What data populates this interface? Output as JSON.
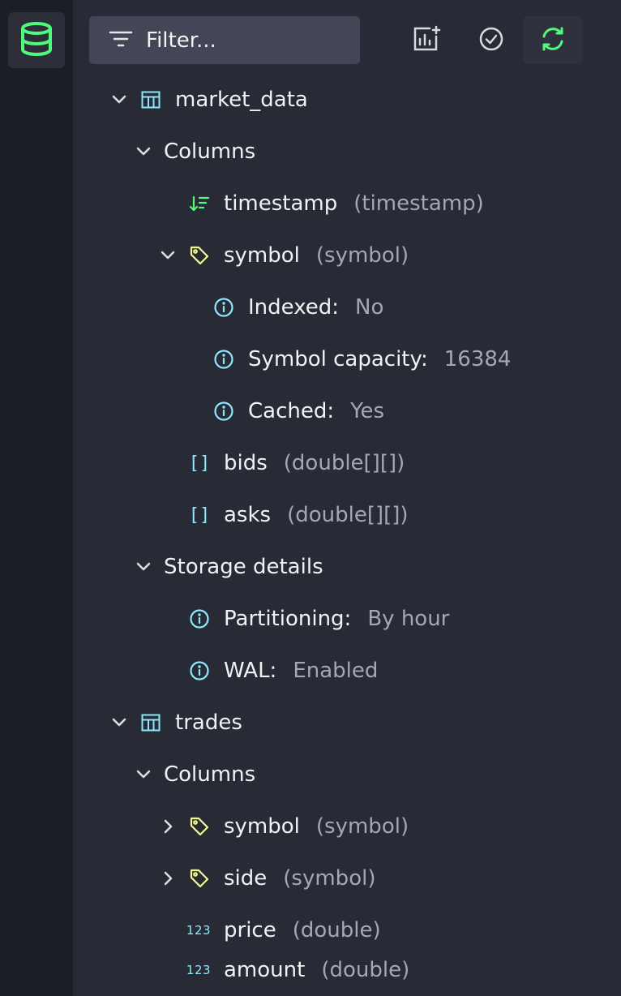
{
  "colors": {
    "accent_green": "#50fa7b",
    "cyan": "#8be9fd",
    "yellow": "#f1fa8c",
    "muted": "#a5a8b3",
    "text": "#f2f2f2",
    "panel_bg": "#282a36",
    "rail_bg": "#1c1e25",
    "filter_bg": "#434657"
  },
  "rail": {
    "icon": "database-icon"
  },
  "toolbar": {
    "filter_placeholder": "Filter...",
    "buttons": [
      "add-chart-icon",
      "check-circle-icon",
      "refresh-icon"
    ]
  },
  "tree": {
    "market_data": {
      "name": "market_data",
      "columns_label": "Columns",
      "columns": {
        "timestamp": {
          "name": "timestamp",
          "type": "(timestamp)"
        },
        "symbol": {
          "name": "symbol",
          "type": "(symbol)",
          "details": [
            {
              "label": "Indexed:",
              "value": "No"
            },
            {
              "label": "Symbol capacity:",
              "value": "16384"
            },
            {
              "label": "Cached:",
              "value": "Yes"
            }
          ]
        },
        "bids": {
          "name": "bids",
          "type": "(double[][])"
        },
        "asks": {
          "name": "asks",
          "type": "(double[][])"
        }
      },
      "storage_label": "Storage details",
      "storage": [
        {
          "label": "Partitioning:",
          "value": "By hour"
        },
        {
          "label": "WAL:",
          "value": "Enabled"
        }
      ]
    },
    "trades": {
      "name": "trades",
      "columns_label": "Columns",
      "columns": [
        {
          "name": "symbol",
          "type": "(symbol)"
        },
        {
          "name": "side",
          "type": "(symbol)"
        },
        {
          "name": "price",
          "type": "(double)",
          "badge": "123"
        },
        {
          "name": "amount",
          "type": "(double)",
          "badge": "123"
        }
      ]
    }
  }
}
